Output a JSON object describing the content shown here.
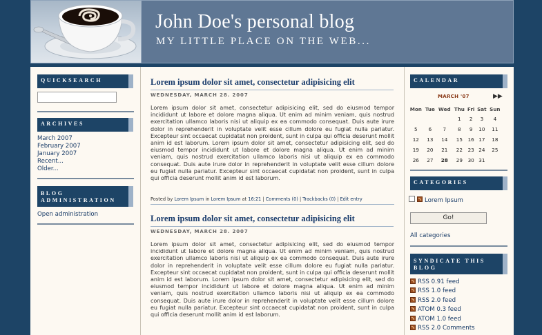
{
  "header": {
    "title": "John Doe's personal blog",
    "subtitle": "MY LITTLE PLACE ON THE WEB..."
  },
  "sidebar_left": {
    "quicksearch": {
      "title": "QUICKSEARCH",
      "value": "",
      "placeholder": ""
    },
    "archives": {
      "title": "ARCHIVES",
      "items": [
        "March 2007",
        "February 2007",
        "January 2007",
        "Recent...",
        "Older..."
      ]
    },
    "admin": {
      "title": "BLOG ADMINISTRATION",
      "link": "Open administration"
    }
  },
  "posts": [
    {
      "title": "Lorem ipsum dolor sit amet, consectetur adipisicing elit",
      "date": "WEDNESDAY, MARCH 28. 2007",
      "body": "Lorem ipsum dolor sit amet, consectetur adipisicing elit, sed do eiusmod tempor incididunt ut labore et dolore magna aliqua. Ut enim ad minim veniam, quis nostrud exercitation ullamco laboris nisi ut aliquip ex ea commodo consequat. Duis aute irure dolor in reprehenderit in voluptate velit esse cillum dolore eu fugiat nulla pariatur. Excepteur sint occaecat cupidatat non proident, sunt in culpa qui officia deserunt mollit anim id est laborum. Lorem ipsum dolor sit amet, consectetur adipisicing elit, sed do eiusmod tempor incididunt ut labore et dolore magna aliqua. Ut enim ad minim veniam, quis nostrud exercitation ullamco laboris nisi ut aliquip ex ea commodo consequat. Duis aute irure dolor in reprehenderit in voluptate velit esse cillum dolore eu fugiat nulla pariatur. Excepteur sint occaecat cupidatat non proident, sunt in culpa qui officia deserunt mollit anim id est laborum.",
      "meta": {
        "posted_by": "Posted by",
        "author": "Lorem Ipsum",
        "in": "in",
        "category": "Lorem Ipsum",
        "at": "at",
        "time": "16:21",
        "comments": "Comments (0)",
        "trackbacks": "Trackbacks (0)",
        "edit": "Edit entry"
      }
    },
    {
      "title": "Lorem ipsum dolor sit amet, consectetur adipisicing elit",
      "date": "WEDNESDAY, MARCH 28. 2007",
      "body": "Lorem ipsum dolor sit amet, consectetur adipisicing elit, sed do eiusmod tempor incididunt ut labore et dolore magna aliqua. Ut enim ad minim veniam, quis nostrud exercitation ullamco laboris nisi ut aliquip ex ea commodo consequat. Duis aute irure dolor in reprehenderit in voluptate velit esse cillum dolore eu fugiat nulla pariatur. Excepteur sint occaecat cupidatat non proident, sunt in culpa qui officia deserunt mollit anim id est laborum. Lorem ipsum dolor sit amet, consectetur adipisicing elit, sed do eiusmod tempor incididunt ut labore et dolore magna aliqua. Ut enim ad minim veniam, quis nostrud exercitation ullamco laboris nisi ut aliquip ex ea commodo consequat. Duis aute irure dolor in reprehenderit in voluptate velit esse cillum dolore eu fugiat nulla pariatur. Excepteur sint occaecat cupidatat non proident, sunt in culpa qui officia deserunt mollit anim id est laborum."
    }
  ],
  "sidebar_right": {
    "calendar": {
      "title": "CALENDAR",
      "month": "MARCH '07",
      "next_icon": "double-arrow-right-icon",
      "weekdays": [
        "Mon",
        "Tue",
        "Wed",
        "Thu",
        "Fri",
        "Sat",
        "Sun"
      ],
      "weeks": [
        [
          "",
          "",
          "",
          "1",
          "2",
          "3",
          "4"
        ],
        [
          "5",
          "6",
          "7",
          "8",
          "9",
          "10",
          "11"
        ],
        [
          "12",
          "13",
          "14",
          "15",
          "16",
          "17",
          "18"
        ],
        [
          "19",
          "20",
          "21",
          "22",
          "23",
          "24",
          "25"
        ],
        [
          "26",
          "27",
          "28",
          "29",
          "30",
          "31",
          ""
        ]
      ],
      "highlighted_day": "28"
    },
    "categories": {
      "title": "CATEGORIES",
      "item": "Lorem Ipsum",
      "go_label": "Go!",
      "all_link": "All categories"
    },
    "syndicate": {
      "title": "SYNDICATE THIS BLOG",
      "feeds": [
        "RSS 0.91 feed",
        "RSS 1.0 feed",
        "RSS 2.0 feed",
        "ATOM 0.3 feed",
        "ATOM 1.0 feed",
        "RSS 2.0 Comments"
      ]
    }
  },
  "colors": {
    "background": "#1d4466",
    "header": "#5f7794",
    "page": "#fdf9f2",
    "link": "#173a66",
    "box_header": "#1d4466",
    "box_accent": "#9eb2c8",
    "calendar_month": "#8a3a18"
  }
}
